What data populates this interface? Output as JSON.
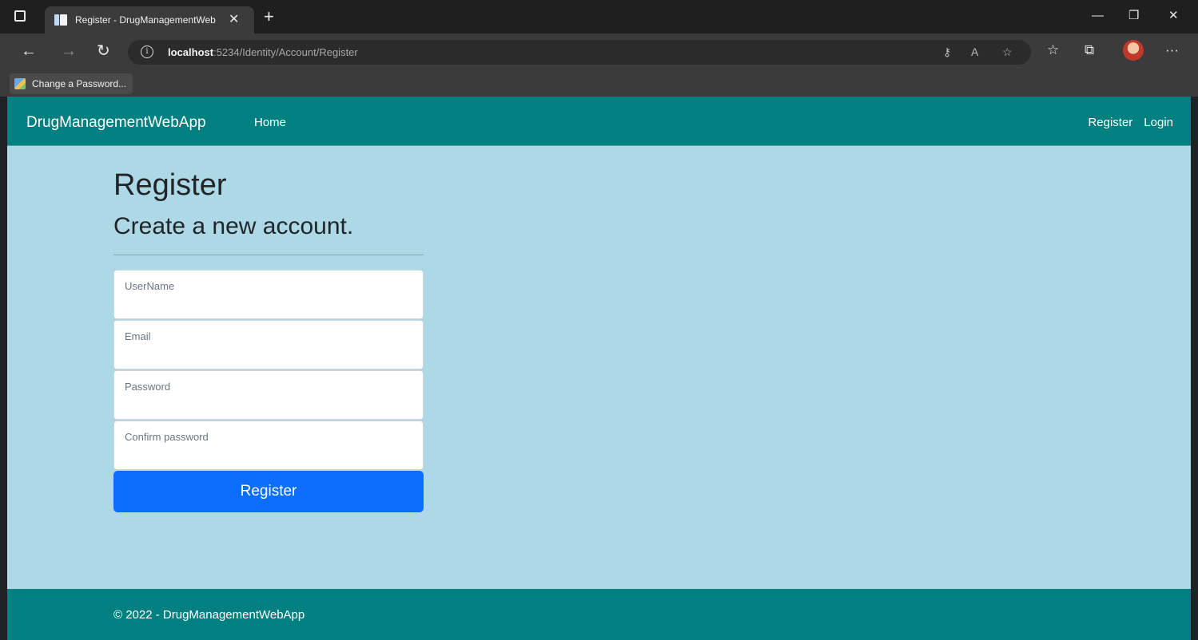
{
  "browser": {
    "tab_title": "Register - DrugManagementWeb",
    "url_host": "localhost",
    "url_rest": ":5234/Identity/Account/Register",
    "favorites": [
      {
        "label": "Change a Password..."
      }
    ]
  },
  "navbar": {
    "brand": "DrugManagementWebApp",
    "home": "Home",
    "register": "Register",
    "login": "Login"
  },
  "page": {
    "title": "Register",
    "subtitle": "Create a new account."
  },
  "form": {
    "username_label": "UserName",
    "email_label": "Email",
    "password_label": "Password",
    "confirm_label": "Confirm password",
    "submit_label": "Register"
  },
  "footer": {
    "text": "© 2022 - DrugManagementWebApp"
  },
  "colors": {
    "navbar": "#008080",
    "page_bg": "#add8e6",
    "primary_button": "#0d6efd"
  }
}
